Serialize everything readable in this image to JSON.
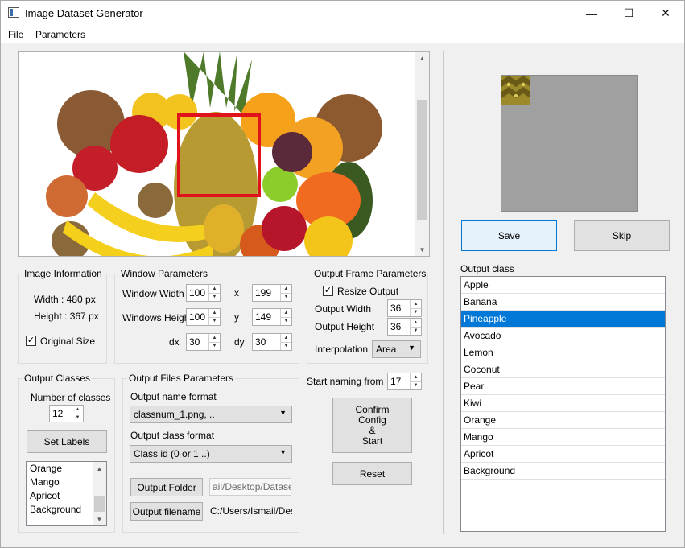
{
  "window": {
    "title": "Image Dataset Generator",
    "min": "—",
    "max": "☐",
    "close": "✕"
  },
  "menu": [
    "File",
    "Parameters"
  ],
  "image_info": {
    "title": "Image Information",
    "width": "Width : 480 px",
    "height": "Height : 367 px",
    "original_size": "Original Size",
    "original_size_checked": true
  },
  "window_params": {
    "title": "Window Parameters",
    "window_width_label": "Window Width",
    "window_width": "100",
    "windows_height_label": "Windows Height",
    "windows_height": "100",
    "x_label": "x",
    "x": "199",
    "y_label": "y",
    "y": "149",
    "dx_label": "dx",
    "dx": "30",
    "dy_label": "dy",
    "dy": "30"
  },
  "output_frame": {
    "title": "Output Frame Parameters",
    "resize_output": "Resize Output",
    "resize_checked": true,
    "output_width_label": "Output Width",
    "output_width": "36",
    "output_height_label": "Output Height",
    "output_height": "36",
    "interpolation_label": "Interpolation",
    "interpolation": "Area"
  },
  "output_classes": {
    "title": "Output Classes",
    "number_label": "Number of classes",
    "number": "12",
    "set_labels": "Set Labels",
    "list": [
      "Orange",
      "Mango",
      "Apricot",
      "Background"
    ]
  },
  "output_files": {
    "title": "Output Files Parameters",
    "name_format_label": "Output name format",
    "name_format": "classnum_1.png, ..",
    "class_format_label": "Output class format",
    "class_format": "Class id (0 or 1 ..)",
    "output_folder": "Output Folder",
    "folder_path": "ail/Desktop/Dataset",
    "output_filename": "Output filename",
    "filename_path": "C:/Users/Ismail/Deskt"
  },
  "start": {
    "label": "Start naming from",
    "value": "17",
    "confirm_line1": "Confirm",
    "confirm_line2": "Config",
    "confirm_line3": "&",
    "confirm_line4": "Start",
    "reset": "Reset"
  },
  "preview": {
    "save": "Save",
    "skip": "Skip"
  },
  "output_class": {
    "title": "Output class",
    "items": [
      "Apple",
      "Banana",
      "Pineapple",
      "Avocado",
      "Lemon",
      "Coconut",
      "Pear",
      "Kiwi",
      "Orange",
      "Mango",
      "Apricot",
      "Background"
    ],
    "selected": "Pineapple"
  },
  "colors": {
    "selection": "#0078d7",
    "crop_box": "#e0121b",
    "primary_button": "#e5f1fb"
  },
  "icons": {
    "checkbox": "check-icon",
    "spin_up": "arrow-up-icon",
    "spin_down": "arrow-down-icon",
    "combo": "chevron-down-icon"
  }
}
